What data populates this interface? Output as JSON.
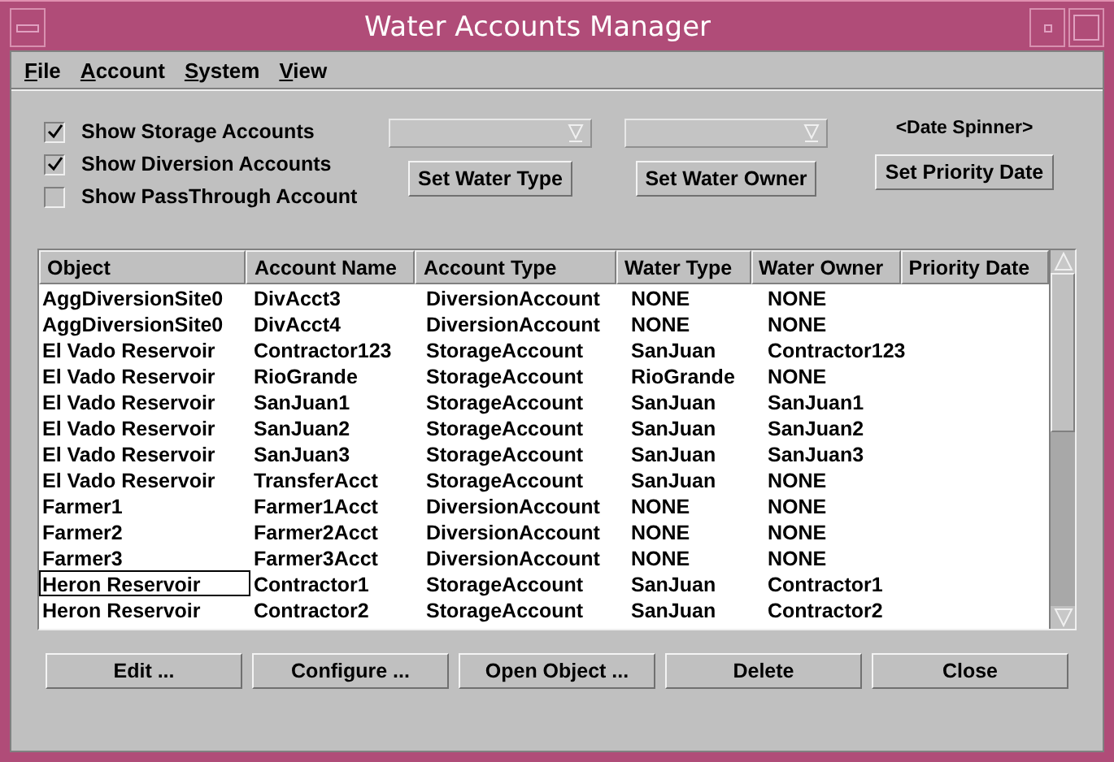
{
  "window": {
    "title": "Water Accounts Manager"
  },
  "menu": [
    "File",
    "Account",
    "System",
    "View"
  ],
  "filters": [
    {
      "label": "Show Storage Accounts",
      "checked": true
    },
    {
      "label": "Show Diversion Accounts",
      "checked": true
    },
    {
      "label": "Show PassThrough Account",
      "checked": false
    }
  ],
  "setters": [
    {
      "dropdown": {
        "disabled": true
      },
      "button": "Set Water Type"
    },
    {
      "dropdown": {
        "disabled": true
      },
      "button": "Set Water Owner"
    }
  ],
  "date": {
    "spinner_label": "<Date Spinner>",
    "button": "Set Priority Date"
  },
  "table": {
    "columns": [
      "Object",
      "Account Name",
      "Account Type",
      "Water Type",
      "Water Owner",
      "Priority Date"
    ],
    "rows": [
      {
        "cells": [
          "AggDiversionSite0",
          "DivAcct3",
          "DiversionAccount",
          "NONE",
          "NONE"
        ],
        "focused": false
      },
      {
        "cells": [
          "AggDiversionSite0",
          "DivAcct4",
          "DiversionAccount",
          "NONE",
          "NONE"
        ],
        "focused": false
      },
      {
        "cells": [
          "El Vado Reservoir",
          "Contractor123",
          "StorageAccount",
          "SanJuan",
          "Contractor123"
        ],
        "focused": false
      },
      {
        "cells": [
          "El Vado Reservoir",
          "RioGrande",
          "StorageAccount",
          "RioGrande",
          "NONE"
        ],
        "focused": false
      },
      {
        "cells": [
          "El Vado Reservoir",
          "SanJuan1",
          "StorageAccount",
          "SanJuan",
          "SanJuan1"
        ],
        "focused": false
      },
      {
        "cells": [
          "El Vado Reservoir",
          "SanJuan2",
          "StorageAccount",
          "SanJuan",
          "SanJuan2"
        ],
        "focused": false
      },
      {
        "cells": [
          "El Vado Reservoir",
          "SanJuan3",
          "StorageAccount",
          "SanJuan",
          "SanJuan3"
        ],
        "focused": false
      },
      {
        "cells": [
          "El Vado Reservoir",
          "TransferAcct",
          "StorageAccount",
          "SanJuan",
          "NONE"
        ],
        "focused": false
      },
      {
        "cells": [
          "Farmer1",
          "Farmer1Acct",
          "DiversionAccount",
          "NONE",
          "NONE"
        ],
        "focused": false
      },
      {
        "cells": [
          "Farmer2",
          "Farmer2Acct",
          "DiversionAccount",
          "NONE",
          "NONE"
        ],
        "focused": false
      },
      {
        "cells": [
          "Farmer3",
          "Farmer3Acct",
          "DiversionAccount",
          "NONE",
          "NONE"
        ],
        "focused": false
      },
      {
        "cells": [
          "Heron Reservoir",
          "Contractor1",
          "StorageAccount",
          "SanJuan",
          "Contractor1"
        ],
        "focused": true
      },
      {
        "cells": [
          "Heron Reservoir",
          "Contractor2",
          "StorageAccount",
          "SanJuan",
          "Contractor2"
        ],
        "focused": false
      }
    ]
  },
  "buttons": [
    "Edit ...",
    "Configure ...",
    "Open Object ...",
    "Delete",
    "Close"
  ]
}
